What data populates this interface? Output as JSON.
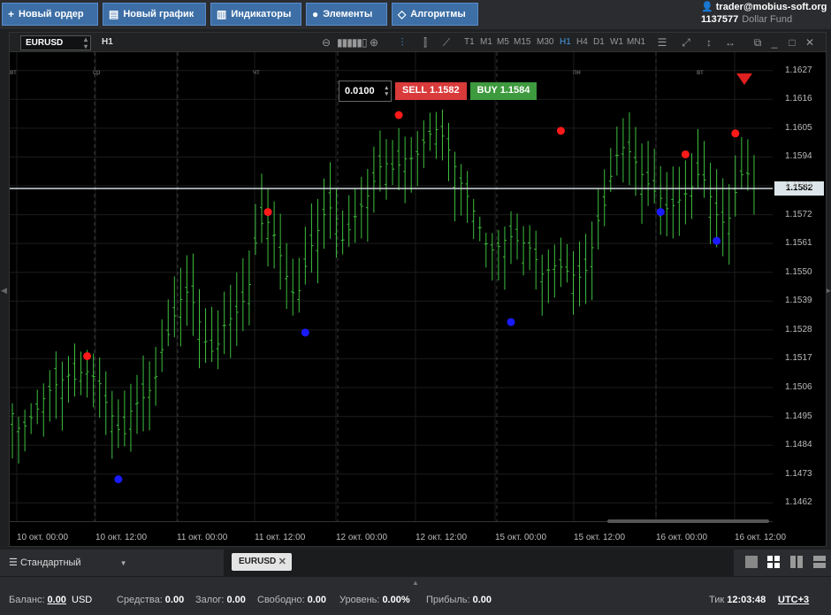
{
  "toolbar_buttons": [
    {
      "icon": "plus-icon",
      "label": "Новый ордер"
    },
    {
      "icon": "chart-icon",
      "label": "Новый график"
    },
    {
      "icon": "indicators-icon",
      "label": "Индикаторы"
    },
    {
      "icon": "elements-icon",
      "label": "Элементы"
    },
    {
      "icon": "algo-icon",
      "label": "Алгоритмы"
    }
  ],
  "user": {
    "email": "trader@mobius-soft.org",
    "account": "1137577",
    "fund": "Dollar Fund"
  },
  "chart": {
    "symbol": "EURUSD",
    "timeframe_current": "H1",
    "timeframes": [
      "T1",
      "M1",
      "M5",
      "M15",
      "M30",
      "H1",
      "H4",
      "D1",
      "W1",
      "MN1"
    ],
    "selected_timeframe": "H1",
    "lot": "0.0100",
    "sell": "SELL 1.1582",
    "buy": "BUY 1.1584",
    "current_price": "1.1582",
    "day_labels": [
      "вт",
      "ср",
      "чт",
      "пн",
      "вт"
    ],
    "colors": {
      "candle": "#3ec03e",
      "sell": "#d93a3a",
      "buy": "#3e9a3e",
      "peak": "#ff1a1a",
      "trough": "#1a1aff"
    }
  },
  "chart_data": {
    "type": "candlestick",
    "symbol": "EURUSD",
    "timeframe": "H1",
    "y_ticks": [
      "1.1627",
      "1.1616",
      "1.1605",
      "1.1594",
      "1.1583",
      "1.1572",
      "1.1561",
      "1.1550",
      "1.1539",
      "1.1528",
      "1.1517",
      "1.1506",
      "1.1495",
      "1.1484",
      "1.1473",
      "1.1462"
    ],
    "ylim": [
      1.1455,
      1.1634
    ],
    "x_ticks": [
      "10 окт. 00:00",
      "10 окт. 12:00",
      "11 окт. 00:00",
      "11 окт. 12:00",
      "12 окт. 00:00",
      "12 окт. 12:00",
      "15 окт. 00:00",
      "15 окт. 12:00",
      "16 окт. 00:00",
      "16 окт. 12:00"
    ],
    "close": [
      1.1496,
      1.1489,
      1.1493,
      1.1497,
      1.1502,
      1.1506,
      1.1508,
      1.1511,
      1.1509,
      1.1513,
      1.1511,
      1.1508,
      1.1499,
      1.1493,
      1.1486,
      1.1497,
      1.1501,
      1.1503,
      1.1508,
      1.1521,
      1.1528,
      1.1538,
      1.1543,
      1.1538,
      1.1528,
      1.1519,
      1.1522,
      1.1531,
      1.1533,
      1.1537,
      1.1545,
      1.1565,
      1.1571,
      1.1566,
      1.1556,
      1.1546,
      1.1539,
      1.1551,
      1.1561,
      1.1568,
      1.1576,
      1.1571,
      1.1561,
      1.1569,
      1.1574,
      1.1579,
      1.1586,
      1.1593,
      1.1589,
      1.1591,
      1.1594,
      1.1593,
      1.1599,
      1.1603,
      1.1605,
      1.1599,
      1.1591,
      1.1583,
      1.1577,
      1.1569,
      1.1561,
      1.1558,
      1.1561,
      1.1564,
      1.1562,
      1.1561,
      1.1558,
      1.1549,
      1.1551,
      1.1553,
      1.1551,
      1.1549,
      1.1548,
      1.1552,
      1.1568,
      1.1575,
      1.1589,
      1.1598,
      1.1597,
      1.1592,
      1.1586,
      1.1582,
      1.1579,
      1.1574,
      1.1576,
      1.1579,
      1.1582,
      1.1588,
      1.1584,
      1.1573,
      1.1569,
      1.1571,
      1.1586,
      1.1589,
      1.1582
    ],
    "high_points": [
      {
        "i": 12,
        "price": 1.1518
      },
      {
        "i": 41,
        "price": 1.1573
      },
      {
        "i": 62,
        "price": 1.161
      },
      {
        "i": 88,
        "price": 1.1604
      },
      {
        "i": 108,
        "price": 1.1595
      },
      {
        "i": 116,
        "price": 1.1603
      }
    ],
    "low_points": [
      {
        "i": 17,
        "price": 1.1471
      },
      {
        "i": 47,
        "price": 1.1527
      },
      {
        "i": 80,
        "price": 1.1531
      },
      {
        "i": 104,
        "price": 1.1573
      },
      {
        "i": 113,
        "price": 1.1562
      }
    ],
    "current_price": 1.1582
  },
  "bottom_tabs": {
    "layout": "Стандартный",
    "tab": "EURUSD"
  },
  "status": {
    "balance_label": "Баланс:",
    "balance": "0.00",
    "currency": "USD",
    "funds_label": "Средства:",
    "funds": "0.00",
    "margin_label": "Залог:",
    "margin": "0.00",
    "free_label": "Свободно:",
    "free": "0.00",
    "level_label": "Уровень:",
    "level": "0.00%",
    "profit_label": "Прибыль:",
    "profit": "0.00",
    "tick_label": "Тик",
    "time": "12:03:48",
    "tz": "UTC+3"
  }
}
